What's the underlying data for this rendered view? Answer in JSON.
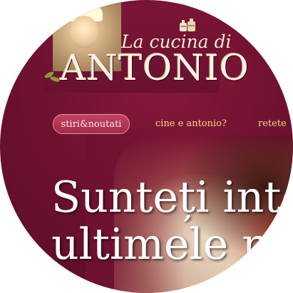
{
  "logo": {
    "tagline": "La cucina di",
    "brand": "ANTONIO",
    "chef_photo_icon": "chef-portrait",
    "pots_icon": "cooking-pots-icon"
  },
  "nav": {
    "items": [
      {
        "label": "stiri&noutati",
        "active": true
      },
      {
        "label": "cine e antonio?",
        "active": false
      },
      {
        "label": "retete",
        "active": false
      }
    ]
  },
  "hero": {
    "line1": "Sunteți inte",
    "line2": "ultimele r"
  },
  "colors": {
    "background": "#6f1230",
    "active_tab": "#b3354f",
    "nav_text": "#f7d98a",
    "headline": "#ffffff"
  }
}
